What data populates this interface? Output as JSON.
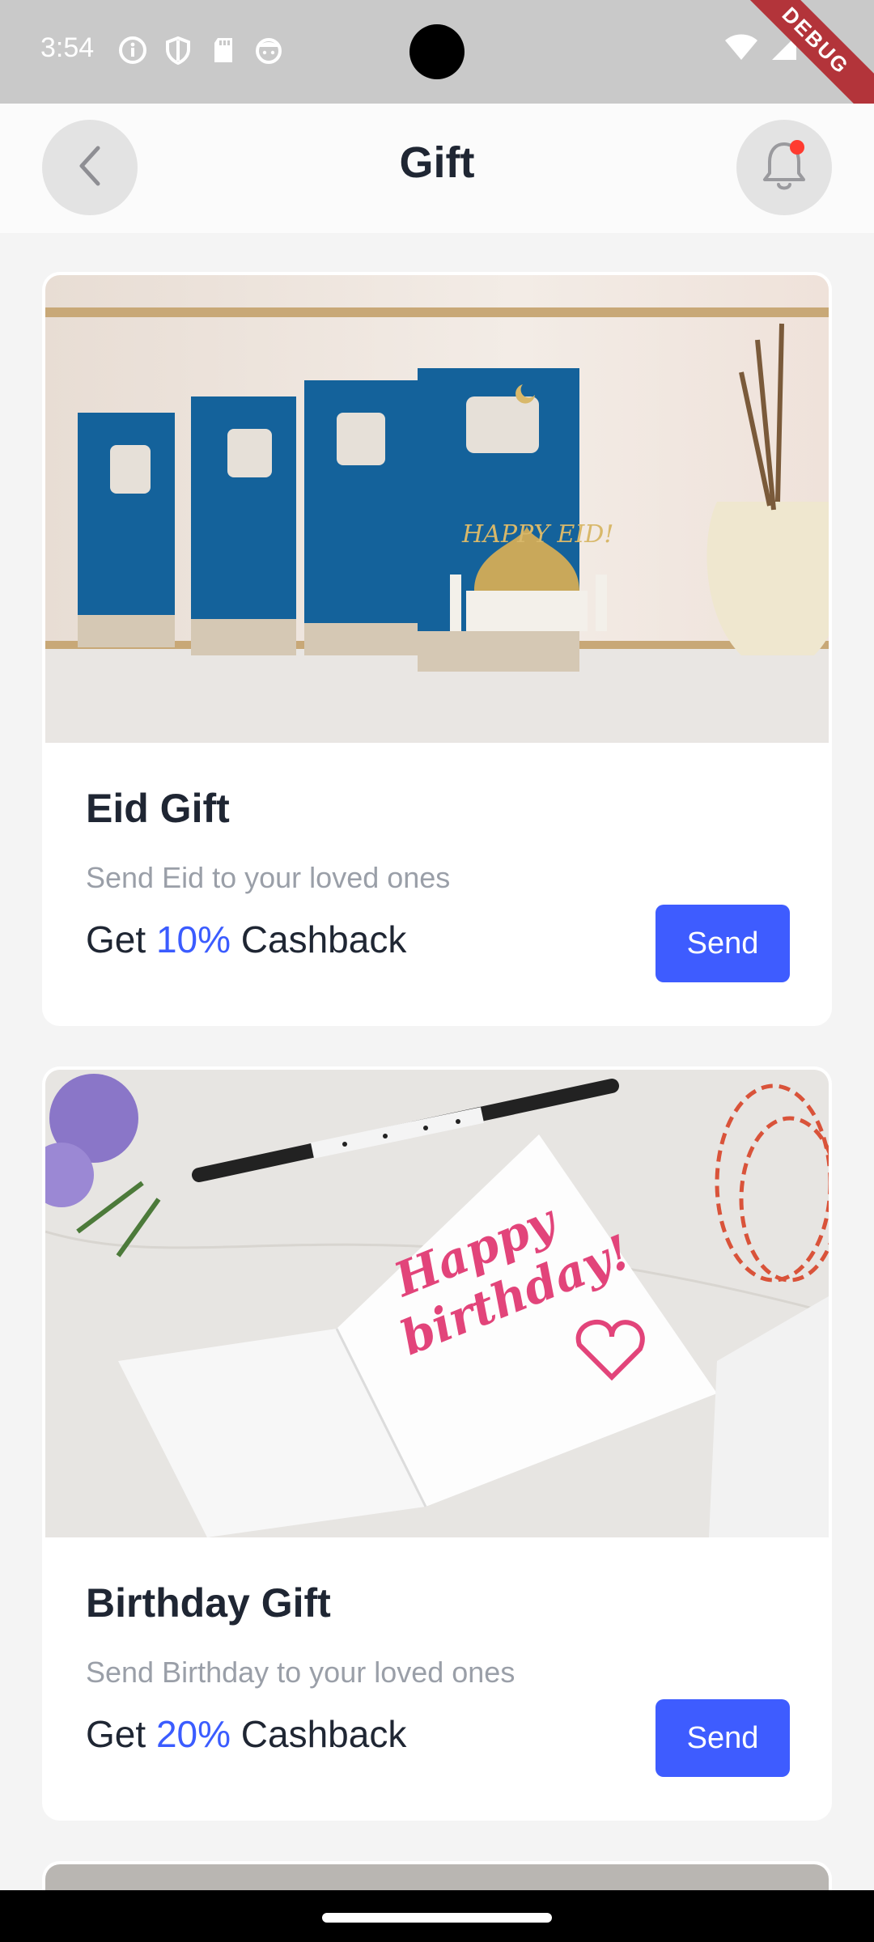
{
  "status_bar": {
    "time": "3:54",
    "debug_label": "DEBUG"
  },
  "header": {
    "title": "Gift",
    "back_icon": "chevron-left-icon",
    "notification_icon": "bell-icon",
    "notification_dot_color": "#ff3b30"
  },
  "cards": [
    {
      "title": "Eid Gift",
      "subtitle": "Send Eid to your loved ones",
      "offer_prefix": "Get",
      "offer_percent": "10%",
      "offer_suffix": "Cashback",
      "button_label": "Send",
      "image_text": "HAPPY EID!"
    },
    {
      "title": "Birthday Gift",
      "subtitle": "Send Birthday to your loved ones",
      "offer_prefix": "Get",
      "offer_percent": "20%",
      "offer_suffix": "Cashback",
      "button_label": "Send",
      "image_text_line1": "Happy",
      "image_text_line2": "birthday!"
    }
  ],
  "colors": {
    "accent": "#3e5cff",
    "title": "#1f2633",
    "subtitle": "#9a9fa8"
  }
}
